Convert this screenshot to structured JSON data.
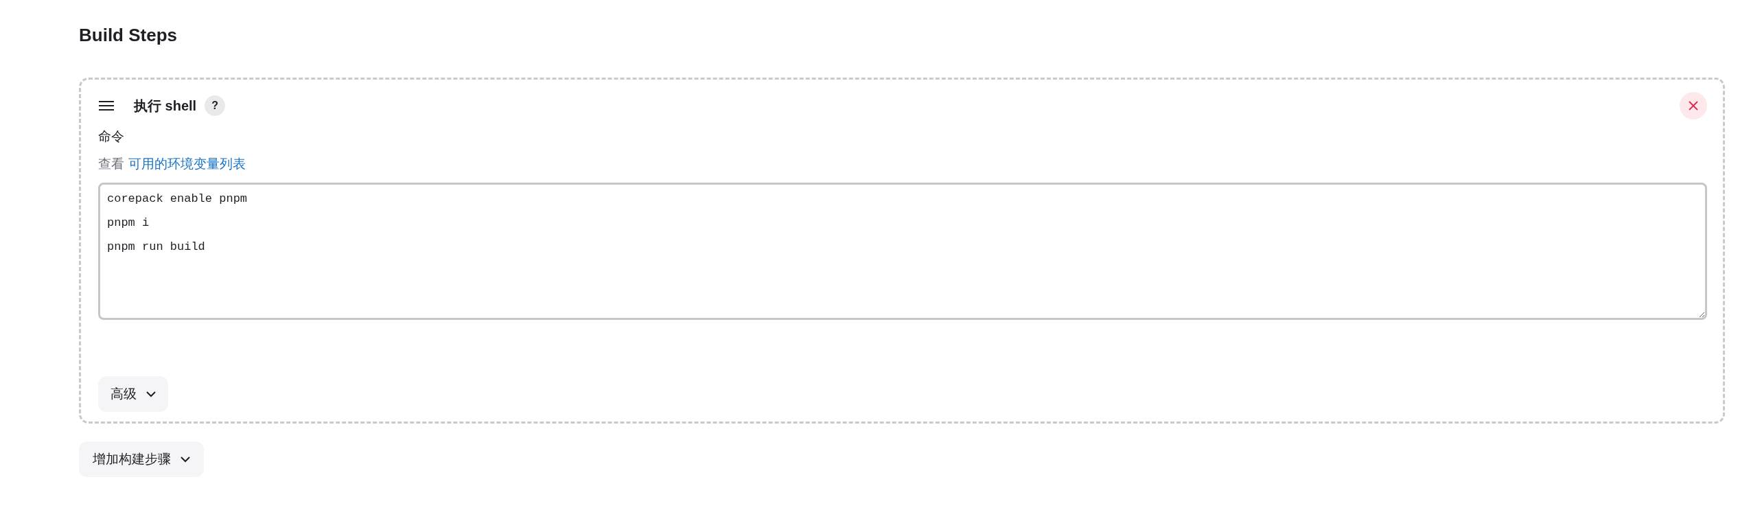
{
  "section_title": "Build Steps",
  "step": {
    "title": "执行 shell",
    "help": "?",
    "field_label": "命令",
    "hint_prefix": "查看",
    "hint_link": "可用的环境变量列表",
    "command": "corepack enable pnpm\npnpm i\npnpm run build",
    "advanced_button": "高级"
  },
  "add_button": "增加构建步骤"
}
